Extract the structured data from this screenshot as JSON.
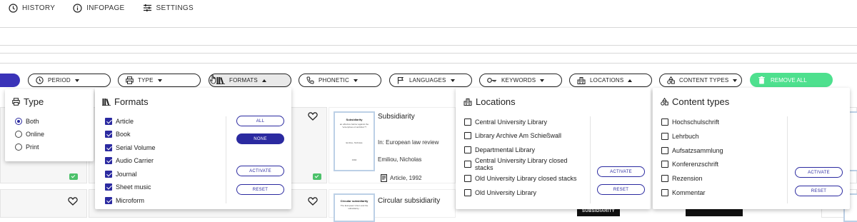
{
  "nav": {
    "history": "HISTORY",
    "infopage": "INFOPAGE",
    "settings": "SETTINGS"
  },
  "filters": {
    "period": "PERIOD",
    "type": "TYPE",
    "formats": "FORMATS",
    "phonetic": "PHONETIC",
    "languages": "LANGUAGES",
    "keywords": "KEYWORDS",
    "locations": "LOCATIONS",
    "content_types": "CONTENT TYPES",
    "remove_all": "REMOVE ALL"
  },
  "type_panel": {
    "title": "Type",
    "options": [
      {
        "label": "Both",
        "selected": true
      },
      {
        "label": "Online",
        "selected": false
      },
      {
        "label": "Print",
        "selected": false
      }
    ]
  },
  "formats_panel": {
    "title": "Formats",
    "items": [
      {
        "label": "Article",
        "checked": true
      },
      {
        "label": "Book",
        "checked": true
      },
      {
        "label": "Serial Volume",
        "checked": true
      },
      {
        "label": "Audio Carrier",
        "checked": true
      },
      {
        "label": "Journal",
        "checked": true
      },
      {
        "label": "Sheet music",
        "checked": true
      },
      {
        "label": "Microform",
        "checked": true
      }
    ],
    "all": "ALL",
    "none": "NONE",
    "activate": "ACTIVATE",
    "reset": "RESET"
  },
  "locations_panel": {
    "title": "Locations",
    "items": [
      "Central University Library",
      "Library Archive Am Schießwall",
      "Departmental Library",
      "Central University Library closed stacks",
      "Old University Library closed stacks",
      "Old University Library"
    ],
    "activate": "ACTIVATE",
    "reset": "RESET"
  },
  "content_panel": {
    "title": "Content types",
    "items": [
      "Hochschulschrift",
      "Lehrbuch",
      "Aufsatzsammlung",
      "Konferenzschrift",
      "Rezension",
      "Kommentar"
    ],
    "activate": "ACTIVATE",
    "reset": "RESET"
  },
  "results": {
    "r1": {
      "title": "Subsidiarity",
      "in": "In: European law review",
      "author": "Emiliou, Nicholas",
      "meta": "Article, 1992",
      "thumb_title": "Subsidiarity",
      "thumb_sub": "an effective barrier against the \"enterprises of ambition\"?",
      "thumb_author": "Emiliou, Nicholas",
      "thumb_year": "1992"
    },
    "r2": {
      "title": "Circular subsidiarity",
      "thumb_title": "Circular subsidiarity",
      "thumb_sub": "The European Union and the subsidiarity..."
    },
    "cover_label": "SUBSIDIARITY"
  },
  "colors": {
    "accent": "#2b2aa0",
    "remove_all_bg": "#4ee08e",
    "check_green": "#4cc16a"
  }
}
